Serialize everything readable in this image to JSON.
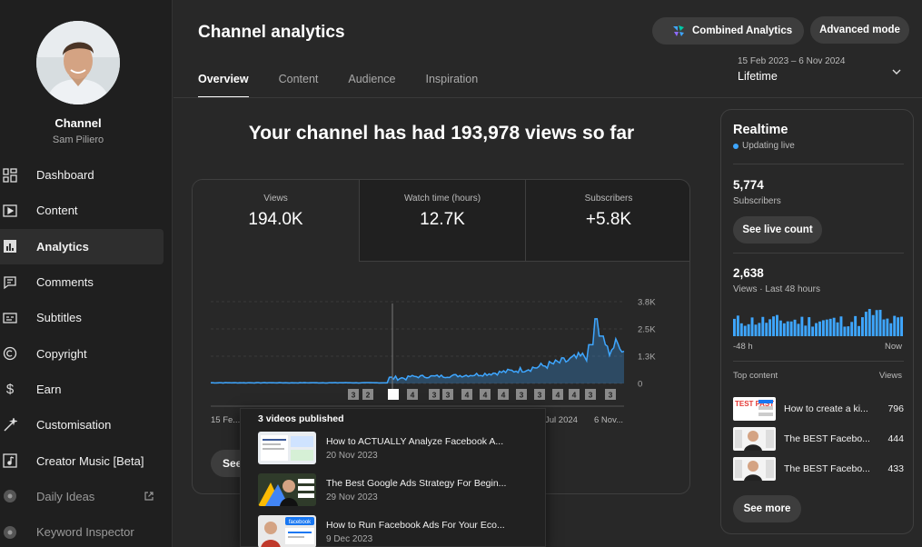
{
  "sidebar": {
    "channel_title": "Channel",
    "channel_name": "Sam Piliero",
    "items": [
      {
        "label": "Dashboard",
        "icon": "dashboard-icon"
      },
      {
        "label": "Content",
        "icon": "content-icon"
      },
      {
        "label": "Analytics",
        "icon": "analytics-icon",
        "active": true
      },
      {
        "label": "Comments",
        "icon": "comments-icon"
      },
      {
        "label": "Subtitles",
        "icon": "subtitles-icon"
      },
      {
        "label": "Copyright",
        "icon": "copyright-icon"
      },
      {
        "label": "Earn",
        "icon": "earn-icon"
      },
      {
        "label": "Customisation",
        "icon": "customisation-icon"
      },
      {
        "label": "Creator Music [Beta]",
        "icon": "creator-music-icon"
      },
      {
        "label": "Daily Ideas",
        "icon": "extension-icon",
        "external": true
      },
      {
        "label": "Keyword Inspector",
        "icon": "extension-icon"
      }
    ]
  },
  "header": {
    "title": "Channel analytics",
    "tabs": [
      "Overview",
      "Content",
      "Audience",
      "Inspiration"
    ],
    "active_tab": "Overview",
    "combined_label": "Combined Analytics",
    "advanced_label": "Advanced mode",
    "date_range": "15 Feb 2023 – 6 Nov 2024",
    "date_label": "Lifetime"
  },
  "main": {
    "headline": "Your channel has had 193,978 views so far",
    "metrics": [
      {
        "label": "Views",
        "value": "194.0K"
      },
      {
        "label": "Watch time (hours)",
        "value": "12.7K"
      },
      {
        "label": "Subscribers",
        "value": "+5.8K"
      }
    ],
    "see_more_label": "See"
  },
  "chart_data": {
    "type": "area",
    "ylabels": [
      "3.8K",
      "2.5K",
      "1.3K",
      "0"
    ],
    "ylim": [
      0,
      3800
    ],
    "xlabels": [
      "15 Fe...",
      "Jul 2024",
      "6 Nov..."
    ],
    "markers": [
      "3",
      "2",
      "",
      "4",
      "3",
      "3",
      "4",
      "4",
      "4",
      "3",
      "3",
      "4",
      "4",
      "3",
      "3"
    ],
    "color": "#3ea6ff"
  },
  "popup": {
    "title": "3 videos published",
    "items": [
      {
        "title": "How to ACTUALLY Analyze Facebook A...",
        "date": "20 Nov 2023"
      },
      {
        "title": "The Best Google Ads Strategy For Begin...",
        "date": "29 Nov 2023"
      },
      {
        "title": "How to Run Facebook Ads For Your Eco...",
        "date": "9 Dec 2023",
        "thumb_text": "facebook"
      }
    ]
  },
  "realtime": {
    "title": "Realtime",
    "live": "Updating live",
    "subs_value": "5,774",
    "subs_label": "Subscribers",
    "live_count_label": "See live count",
    "views_value": "2,638",
    "views_label": "Views · Last 48 hours",
    "axis_left": "-48 h",
    "axis_right": "Now",
    "top_content_label": "Top content",
    "views_col": "Views",
    "top_items": [
      {
        "title": "How to create a ki...",
        "views": "796",
        "thumb_text": "TEST FAST"
      },
      {
        "title": "The BEST Facebo...",
        "views": "444"
      },
      {
        "title": "The BEST Facebo...",
        "views": "433"
      }
    ],
    "see_more_label": "See more"
  }
}
